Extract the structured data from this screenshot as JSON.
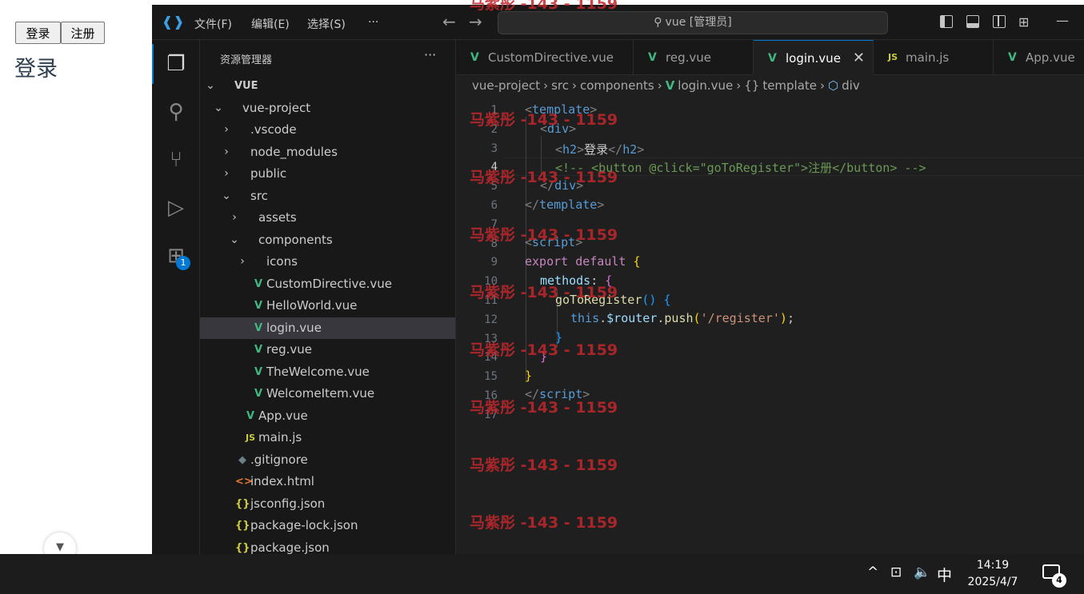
{
  "browser": {
    "btn_login": "登录",
    "btn_register": "注册",
    "heading": "登录"
  },
  "titlebar": {
    "menus": [
      "文件(F)",
      "编辑(E)",
      "选择(S)",
      "···"
    ],
    "search": "vue [管理员]"
  },
  "activity": {
    "extensions_badge": "1"
  },
  "explorer": {
    "title": "资源管理器",
    "more": "···",
    "items": [
      {
        "label": "VUE",
        "chev": "⌄",
        "icon": ""
      },
      {
        "label": "vue-project",
        "chev": "⌄",
        "icon": ""
      },
      {
        "label": ".vscode",
        "chev": "›",
        "icon": ""
      },
      {
        "label": "node_modules",
        "chev": "›",
        "icon": ""
      },
      {
        "label": "public",
        "chev": "›",
        "icon": ""
      },
      {
        "label": "src",
        "chev": "⌄",
        "icon": ""
      },
      {
        "label": "assets",
        "chev": "›",
        "icon": ""
      },
      {
        "label": "components",
        "chev": "⌄",
        "icon": ""
      },
      {
        "label": "icons",
        "chev": "›",
        "icon": ""
      },
      {
        "label": "CustomDirective.vue",
        "chev": "",
        "icon": "V"
      },
      {
        "label": "HelloWorld.vue",
        "chev": "",
        "icon": "V"
      },
      {
        "label": "login.vue",
        "chev": "",
        "icon": "V"
      },
      {
        "label": "reg.vue",
        "chev": "",
        "icon": "V"
      },
      {
        "label": "TheWelcome.vue",
        "chev": "",
        "icon": "V"
      },
      {
        "label": "WelcomeItem.vue",
        "chev": "",
        "icon": "V"
      },
      {
        "label": "App.vue",
        "chev": "",
        "icon": "V"
      },
      {
        "label": "main.js",
        "chev": "",
        "icon": "JS"
      },
      {
        "label": ".gitignore",
        "chev": "",
        "icon": "◆"
      },
      {
        "label": "index.html",
        "chev": "",
        "icon": "<>"
      },
      {
        "label": "jsconfig.json",
        "chev": "",
        "icon": "{}"
      },
      {
        "label": "package-lock.json",
        "chev": "",
        "icon": "{}"
      },
      {
        "label": "package.json",
        "chev": "",
        "icon": "{}"
      }
    ]
  },
  "tabs": [
    {
      "label": "CustomDirective.vue",
      "icon": "V"
    },
    {
      "label": "reg.vue",
      "icon": "V"
    },
    {
      "label": "login.vue",
      "icon": "V",
      "close": "✕"
    },
    {
      "label": "main.js",
      "icon": "JS"
    },
    {
      "label": "App.vue",
      "icon": "V"
    }
  ],
  "breadcrumb": [
    "vue-project",
    "›",
    "src",
    "›",
    "components",
    "›",
    "V",
    "login.vue",
    "›",
    "{}",
    "template",
    "›",
    "⬡",
    "div"
  ],
  "code": {
    "line_numbers": [
      "1",
      "2",
      "3",
      "4",
      "5",
      "6",
      "7",
      "8",
      "9",
      "10",
      "11",
      "12",
      "13",
      "14",
      "15",
      "16",
      "17"
    ],
    "l1": [
      "<",
      "template",
      ">"
    ],
    "l2": [
      "<",
      "div",
      ">"
    ],
    "l3": [
      "<",
      "h2",
      ">",
      "登录",
      "</",
      "h2",
      ">"
    ],
    "l4": "<!-- <button @click=\"goToRegister\">注册</button> -->",
    "l5": [
      "</",
      "div",
      ">"
    ],
    "l6": [
      "</",
      "template",
      ">"
    ],
    "l8": [
      "<",
      "script",
      ">"
    ],
    "l9": [
      "export",
      "default",
      "{"
    ],
    "l10": [
      "methods",
      ":",
      "{"
    ],
    "l11": [
      "goToRegister",
      "()",
      "{"
    ],
    "l12": [
      "this",
      ".",
      "$router",
      ".",
      "push",
      "(",
      "'/register'",
      ")",
      ";"
    ],
    "l13": "}",
    "l14": "}",
    "l15": "}",
    "l16": [
      "</",
      "script",
      ">"
    ]
  },
  "watermark": "马紫彤 -143 - 1159",
  "taskbar": {
    "up": "^",
    "network": "⊡",
    "volume": "🔈",
    "ime": "中",
    "time": "14:19",
    "date": "2025/4/7",
    "notif_count": "4"
  },
  "colors": {
    "accent": "#0078d4",
    "vue_green": "#41b883",
    "js_yellow": "#cbcb41",
    "watermark": "#c0282d"
  }
}
